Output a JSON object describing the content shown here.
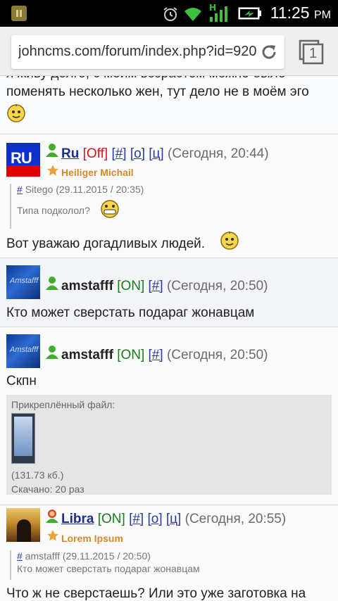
{
  "status_bar": {
    "time": "11:25",
    "ampm": "PM",
    "network": "H"
  },
  "browser": {
    "url": "johncms.com/forum/index.php?id=920",
    "tab_count": "1"
  },
  "top_post": {
    "line1": "я живу долго, с моим возрастом можно было",
    "line2": "поменять несколько жен, тут дело не в моём эго"
  },
  "posts": [
    {
      "nick": "Ru",
      "status": "[Off]",
      "links": [
        "[#]",
        "[о]",
        "[ц]"
      ],
      "date": "(Сегодня, 20:44)",
      "user_status": "Heiliger Michail",
      "avatar_text": "RU",
      "quote_link": "#",
      "quote_author": "Sitego (29.11.2015 / 20:35)",
      "quote_text": "Типа подколол?",
      "text": "Вот уважаю догадливых людей."
    },
    {
      "nick": "amstafff",
      "status": "[ON]",
      "links": [
        "[#]"
      ],
      "date": "(Сегодня, 20:50)",
      "avatar_text": "Amstafff",
      "text": "Кто может сверстать подараг жонавцам"
    },
    {
      "nick": "amstafff",
      "status": "[ON]",
      "links": [
        "[#]"
      ],
      "date": "(Сегодня, 20:50)",
      "avatar_text": "Amstafff",
      "text": "Скпн",
      "attachment": {
        "label": "Прикреплённый файл:",
        "size": "(131.73 кб.)",
        "downloads": "Скачано: 20 раз"
      }
    },
    {
      "nick": "Libra",
      "status": "[ON]",
      "links": [
        "[#]",
        "[о]",
        "[ц]"
      ],
      "date": "(Сегодня, 20:55)",
      "user_status": "Lorem Ipsum",
      "quote_link": "#",
      "quote_author": "amstafff (29.11.2015 / 20:50)",
      "quote_text": "Кто может сверстать подараг жонавцам",
      "text": "Что ж не сверстаешь? Или это уже заготовка на"
    }
  ]
}
